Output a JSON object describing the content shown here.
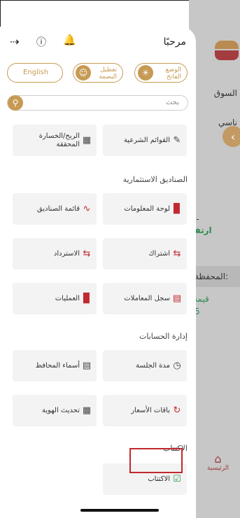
{
  "background": {
    "text_market": "السوق",
    "text_partial": "ناسي",
    "text_dash": "--",
    "text_arrow": "ارتفا",
    "text_wallet": "المحفظة:",
    "text_value": "قيمة",
    "text_value_num": "5",
    "home_label": "الرئيسية"
  },
  "drawer": {
    "greeting": "مرحبًا",
    "pills": {
      "english": "English",
      "fingerprint": "تعطيل البصمة",
      "lightmode": "الوضع الفاتح"
    },
    "search_placeholder": "بحث",
    "cards": {
      "financial_statements": "القوائم الشرعية",
      "realized_pl": "الربح/الخسارة المحققة",
      "dashboard": "لوحة المعلومات",
      "fund_list": "قائمة الصناديق",
      "subscription": "اشتراك",
      "redemption": "الاسترداد",
      "transactions_log": "سجل المعاملات",
      "operations": "العمليات",
      "session_duration": "مدة الجلسة",
      "portfolio_names": "أسماء المحافظ",
      "price_packages": "باقات الأسعار",
      "update_id": "تحديث الهوية",
      "ipo": "الاكتتاب"
    },
    "sections": {
      "investment_funds": "الصناديق الاستثمارية",
      "account_management": "إدارة الحسابات",
      "ipo": "الاكتتاب"
    }
  },
  "colors": {
    "gold": "#c79a54",
    "red": "#c0292f",
    "green": "#2f9a4e"
  }
}
